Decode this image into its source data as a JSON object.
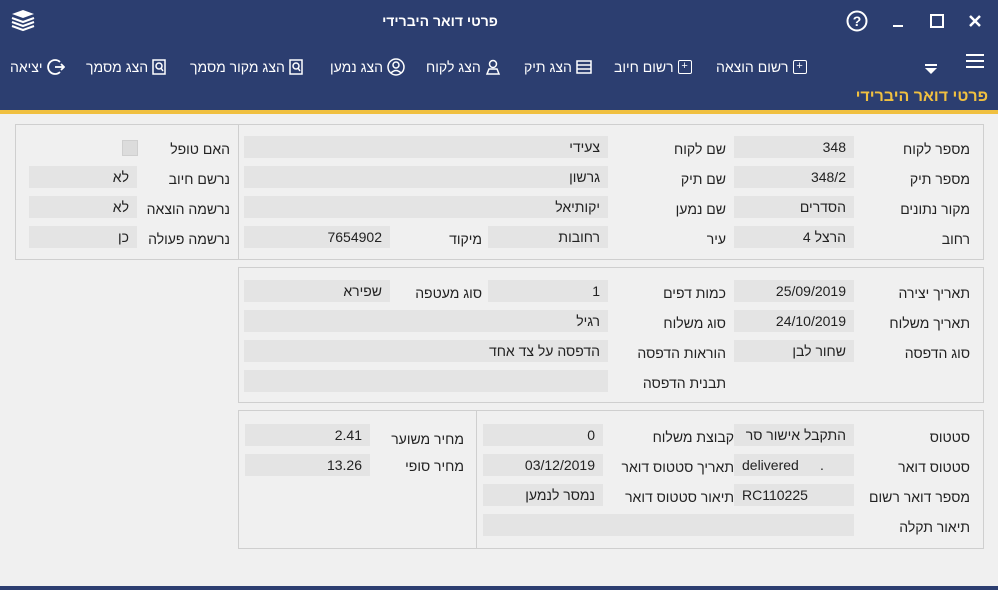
{
  "window": {
    "title": "פרטי דואר היברידי",
    "help_icon": "question-circle-icon",
    "minimize_icon": "minimize-icon",
    "maximize_icon": "maximize-icon",
    "close_icon": "close-icon"
  },
  "toolbar": {
    "menu_icon": "hamburger-icon",
    "dropdown_icon": "caret-down-icon",
    "items": [
      {
        "label": "רשום הוצאה",
        "icon": "plus-square-icon"
      },
      {
        "label": "רשום חיוב",
        "icon": "plus-square-icon"
      },
      {
        "label": "הצג תיק",
        "icon": "folder-icon"
      },
      {
        "label": "הצג לקוח",
        "icon": "user-stamp-icon"
      },
      {
        "label": "הצג נמען",
        "icon": "user-circle-icon"
      },
      {
        "label": "הצג מקור מסמך",
        "icon": "document-search-icon"
      },
      {
        "label": "הצג מסמך",
        "icon": "document-search-icon"
      },
      {
        "label": "יציאה",
        "icon": "exit-icon"
      }
    ]
  },
  "header": {
    "title": "פרטי דואר היברידי"
  },
  "section1": {
    "customer_number": {
      "label": "מספר לקוח",
      "value": "348"
    },
    "file_number": {
      "label": "מספר תיק",
      "value": "348/2"
    },
    "data_source": {
      "label": "מקור נתונים",
      "value": "הסדרים"
    },
    "street": {
      "label": "רחוב",
      "value": "הרצל 4"
    },
    "customer_name": {
      "label": "שם לקוח",
      "value": "צעידי"
    },
    "file_name": {
      "label": "שם תיק",
      "value": "גרשון"
    },
    "recipient_name": {
      "label": "שם נמען",
      "value": "יקותיאל"
    },
    "city": {
      "label": "עיר",
      "value": "רחובות"
    },
    "zip": {
      "label": "מיקוד",
      "value": "7654902"
    },
    "handled": {
      "label": "האם טופל"
    },
    "charge_recorded": {
      "label": "נרשם חיוב",
      "value": "לא"
    },
    "expense_recorded": {
      "label": "נרשמה הוצאה",
      "value": "לא"
    },
    "action_recorded": {
      "label": "נרשמה פעולה",
      "value": "כן"
    }
  },
  "section2": {
    "created_date": {
      "label": "תאריך יצירה",
      "value": "25/09/2019"
    },
    "sent_date": {
      "label": "תאריך משלוח",
      "value": "24/10/2019"
    },
    "print_type": {
      "label": "סוג הדפסה",
      "value": "שחור לבן"
    },
    "page_count": {
      "label": "כמות דפים",
      "value": "1"
    },
    "shipping_type": {
      "label": "סוג משלוח",
      "value": "רגיל"
    },
    "print_instructions": {
      "label": "הוראות הדפסה",
      "value": "הדפסה על צד אחד"
    },
    "print_template": {
      "label": "תבנית הדפסה",
      "value": ""
    },
    "envelope_type": {
      "label": "סוג מעטפה",
      "value": "שפירא"
    }
  },
  "section3": {
    "status": {
      "label": "סטטוס",
      "value": "התקבל אישור סר"
    },
    "mail_status": {
      "label": "סטטוס דואר",
      "value": "delivered",
      "extra": "."
    },
    "registered_number": {
      "label": "מספר דואר רשום",
      "value": "RC110225"
    },
    "failure_desc": {
      "label": "תיאור תקלה",
      "value": ""
    },
    "shipping_group": {
      "label": "קבוצת משלוח",
      "value": "0"
    },
    "mail_status_date": {
      "label": "תאריך סטטוס דואר",
      "value": "03/12/2019"
    },
    "mail_status_desc": {
      "label": "תיאור סטטוס דואר",
      "value": "נמסר לנמען"
    },
    "estimated_price": {
      "label": "מחיר משוער",
      "value": "2.41"
    },
    "final_price": {
      "label": "מחיר סופי",
      "value": "13.26"
    }
  },
  "colors": {
    "primary": "#2c3e70",
    "accent": "#f0c040",
    "field_bg": "#e4e4e4"
  }
}
